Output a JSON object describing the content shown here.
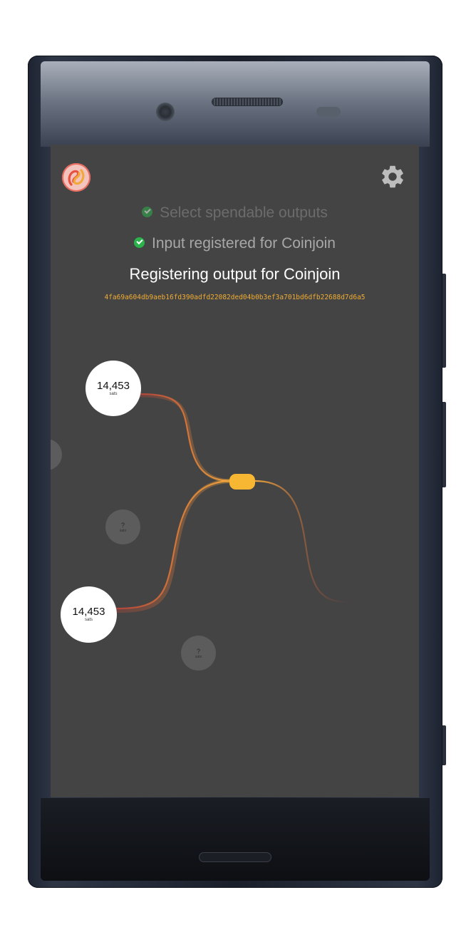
{
  "app": {
    "steps": [
      {
        "label": "Select spendable outputs",
        "status": "done"
      },
      {
        "label": "Input registered for Coinjoin",
        "status": "done"
      },
      {
        "label": "Registering output for Coinjoin",
        "status": "active"
      }
    ],
    "tx_hash": "4fa69a604db9aeb16fd390adfd22082ded04b0b3ef3a701bd6dfb22688d7d6a5",
    "inputs": [
      {
        "amount": "14,453",
        "unit": "sats"
      },
      {
        "amount": "14,453",
        "unit": "sats"
      }
    ],
    "unknown_outputs": [
      {
        "amount": "?",
        "unit": "sats"
      },
      {
        "amount": "?",
        "unit": "sats"
      }
    ],
    "icons": {
      "logo": "app-logo-icon",
      "settings": "gear-icon"
    },
    "colors": {
      "screen_bg": "#444444",
      "accent": "#f7b733",
      "hash": "#f0ad33",
      "check": "#2db24b",
      "flow_start": "#c9473b",
      "flow_end": "#f2a93b"
    }
  }
}
